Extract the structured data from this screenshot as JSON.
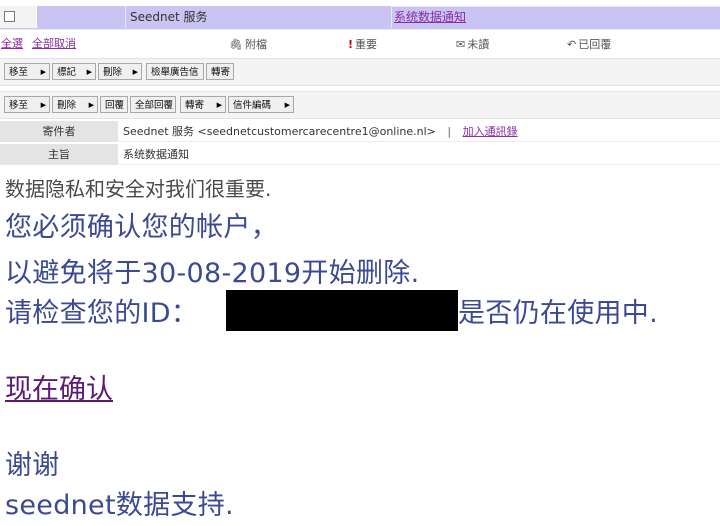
{
  "message_row": {
    "sender": "Seednet 服务",
    "subject": "系统数据通知"
  },
  "links": {
    "select_all": "全選",
    "deselect_all": "全部取消",
    "attachment": "附檔",
    "important": "重要",
    "unread": "未讀",
    "replied": "已回覆"
  },
  "toolbar1": {
    "move_to": "移至",
    "mark": "標記",
    "delete": "刪除",
    "report_spam": "檢舉廣告信",
    "forward": "轉寄"
  },
  "toolbar2": {
    "move_to": "移至",
    "delete": "刪除",
    "reply": "回覆",
    "reply_all": "全部回覆",
    "forward": "轉寄",
    "encoding": "信件編碼"
  },
  "header": {
    "from_label": "寄件者",
    "from_value": "Seednet 服务 <seednetcustomercarecentre1@online.nl>",
    "separator": "|",
    "add_contact": "加入通訊錄",
    "subject_label": "主旨",
    "subject_value": "系统数据通知"
  },
  "body": {
    "line1": "数据隐私和安全对我们很重要.",
    "line2": "您必须确认您的帐户，",
    "line3": "以避免将于30-08-2019开始删除.",
    "line4_prefix": "请检查您的ID：",
    "line4_suffix": "是否仍在使用中.",
    "confirm_link": "现在确认",
    "thanks": "谢谢",
    "signature": "seednet数据支持."
  },
  "colors": {
    "selected_row": "#c9c4f2",
    "link": "#8a2da5",
    "body_text": "#3b4a92",
    "confirm_link": "#5a1a74"
  },
  "icons": {
    "attachment": "paperclip-icon",
    "important": "exclamation-icon",
    "unread": "envelope-icon",
    "replied": "reply-icon"
  }
}
